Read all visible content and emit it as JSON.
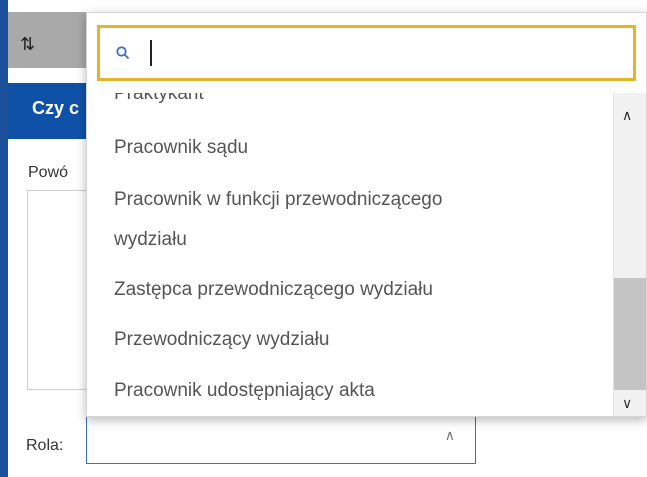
{
  "background": {
    "sort_icon": "⇅",
    "dialog_title": "Czy c",
    "reason_label": "Powó",
    "role_label": "Rola:",
    "role_value": ""
  },
  "dropdown": {
    "search": {
      "value": "",
      "icon": "search-icon"
    },
    "options": [
      "Praktykant",
      "Pracownik sądu",
      "Pracownik w funkcji przewodniczącego",
      "wydziału",
      "Zastępca przewodniczącego wydziału",
      "Przewodniczący wydziału",
      "Pracownik udostępniający akta"
    ]
  },
  "colors": {
    "accent_blue": "#1051a8",
    "search_border": "#e2b62a"
  }
}
